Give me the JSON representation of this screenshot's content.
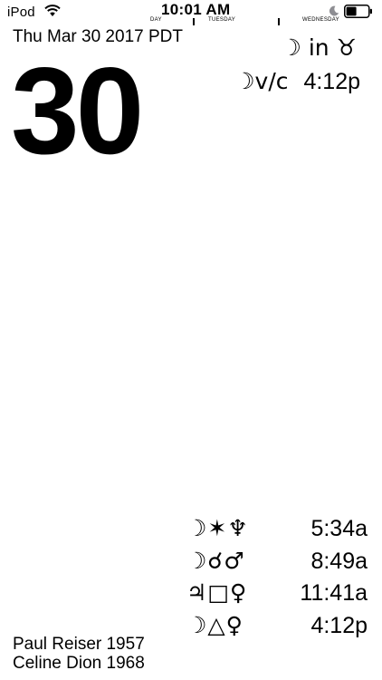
{
  "status_bar": {
    "carrier": "iPod",
    "time": "10:01 AM",
    "timeline_labels": [
      "DAY",
      "TUESDAY",
      "WEDNESDAY"
    ]
  },
  "date_line": "Thu Mar 30 2017 PDT",
  "day_number": "30",
  "moon": {
    "sign_text": "☽ in ♉",
    "voc_label": "☽v/c",
    "voc_time": "4:12p"
  },
  "aspects": [
    {
      "glyphs": "☽✶♆",
      "time": "5:34a"
    },
    {
      "glyphs": "☽☌♂",
      "time": "8:49a"
    },
    {
      "glyphs": "♃□♀",
      "time": "11:41a"
    },
    {
      "glyphs": "☽△♀",
      "time": "4:12p"
    }
  ],
  "birthdays": [
    "Paul Reiser 1957",
    "Celine Dion 1968"
  ],
  "icons": {
    "wifi": "wifi-icon",
    "moon": "moon-icon",
    "battery": "battery-icon"
  }
}
